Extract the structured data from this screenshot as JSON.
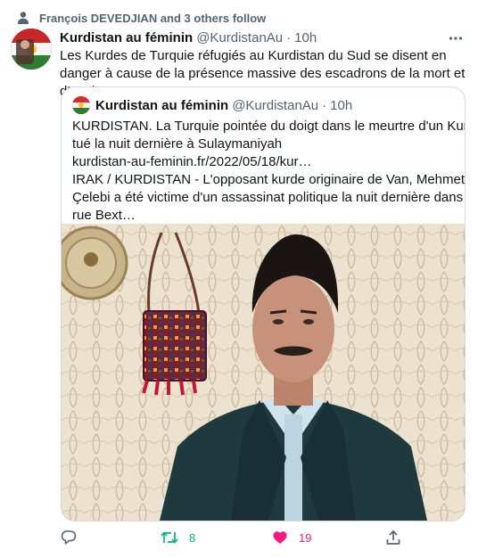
{
  "social_context": "François DEVEDJIAN and 3 others follow",
  "tweet": {
    "name": "Kurdistan au féminin",
    "handle": "@KurdistanAu",
    "separator": "·",
    "time": "10h",
    "text": "Les Kurdes de Turquie réfugiés au Kurdistan du Sud se disent en danger à cause de la présence massive des escadrons de la mort et d’espions turcs."
  },
  "quote": {
    "name": "Kurdistan au féminin",
    "handle": "@KurdistanAu",
    "separator": "·",
    "time": "10h",
    "lines": [
      "KURDISTAN. La Turquie pointée du doigt dans le meurtre d'un Kurde",
      "tué la nuit dernière à Sulaymaniyah",
      "kurdistan-au-feminin.fr/2022/05/18/kur…",
      "IRAK / KURDISTAN - L'opposant kurde originaire de Van, Mehmet Zeki",
      "Çelebi a été victime d'un assassinat politique la nuit dernière dans la",
      "rue Bext…"
    ]
  },
  "actions": {
    "reply_count": "",
    "retweet_count": "8",
    "like_count": "19"
  },
  "icons": {
    "context": "person-icon",
    "more": "more-icon",
    "reply": "reply-icon",
    "retweet": "retweet-icon",
    "like": "heart-icon",
    "share": "share-icon"
  },
  "colors": {
    "text": "#0f1419",
    "muted": "#536471",
    "retweet_green": "#00ba7c",
    "like_pink": "#f91880",
    "border": "#cfd9de"
  }
}
